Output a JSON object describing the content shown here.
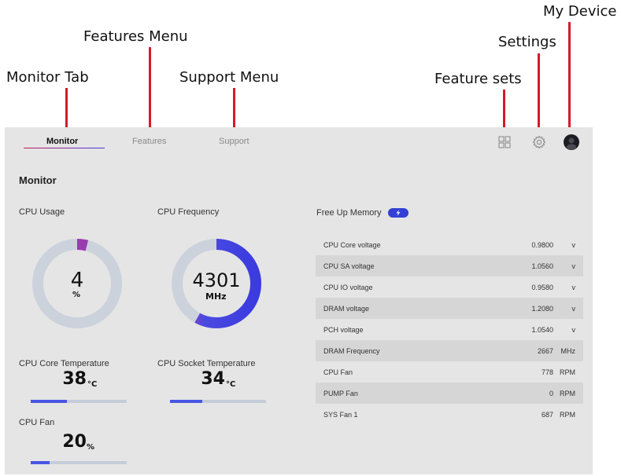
{
  "callouts": {
    "monitor_tab": "Monitor Tab",
    "features_menu": "Features Menu",
    "support_menu": "Support Menu",
    "feature_sets": "Feature sets",
    "settings": "Settings",
    "my_device": "My Device"
  },
  "tabs": [
    {
      "label": "Monitor",
      "active": true
    },
    {
      "label": "Features",
      "active": false
    },
    {
      "label": "Support",
      "active": false
    }
  ],
  "header_icons": [
    "feature-sets-icon",
    "gear-icon",
    "avatar"
  ],
  "section_title": "Monitor",
  "cpu_usage": {
    "label": "CPU Usage",
    "value": "4",
    "unit": "%",
    "fraction": 0.04
  },
  "cpu_frequency": {
    "label": "CPU Frequency",
    "value": "4301",
    "unit": "MHz",
    "fraction": 0.58
  },
  "cpu_core_temp": {
    "label": "CPU Core Temperature",
    "value": "38",
    "unit": "°C",
    "fraction": 0.38
  },
  "cpu_socket_temp": {
    "label": "CPU Socket Temperature",
    "value": "34",
    "unit": "°C",
    "fraction": 0.34
  },
  "cpu_fan": {
    "label": "CPU Fan",
    "value": "20",
    "unit": "%",
    "fraction": 0.2
  },
  "free_up_memory": {
    "label": "Free Up Memory"
  },
  "stats": [
    {
      "label": "CPU Core voltage",
      "value": "0.9800",
      "unit": "v"
    },
    {
      "label": "CPU SA voltage",
      "value": "1.0560",
      "unit": "v"
    },
    {
      "label": "CPU IO voltage",
      "value": "0.9580",
      "unit": "v"
    },
    {
      "label": "DRAM voltage",
      "value": "1.2080",
      "unit": "v"
    },
    {
      "label": "PCH voltage",
      "value": "1.0540",
      "unit": "v"
    },
    {
      "label": "DRAM Frequency",
      "value": "2667",
      "unit": "MHz"
    },
    {
      "label": "CPU Fan",
      "value": "778",
      "unit": "RPM"
    },
    {
      "label": "PUMP Fan",
      "value": "0",
      "unit": "RPM"
    },
    {
      "label": "SYS Fan 1",
      "value": "687",
      "unit": "RPM"
    }
  ],
  "colors": {
    "accent": "#3b3be0",
    "accent_start": "#b03aa8",
    "track": "#ccd2dc",
    "panel": "#e5e5e5",
    "callout_line": "#d6192b"
  }
}
